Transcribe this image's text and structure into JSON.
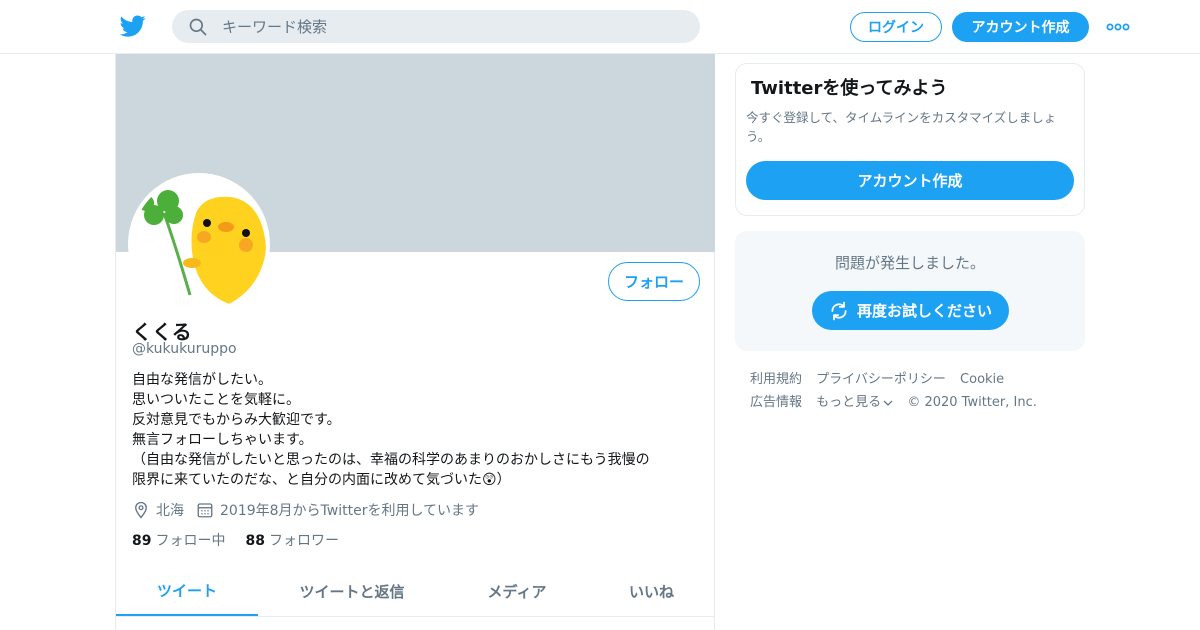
{
  "header": {
    "search_placeholder": "キーワード検索",
    "login_label": "ログイン",
    "signup_label": "アカウント作成"
  },
  "profile": {
    "follow_label": "フォロー",
    "display_name": "くくる",
    "handle": "@kukukuruppo",
    "bio_lines": [
      "自由な発信がしたい。",
      "思いついたことを気軽に。",
      "反対意見でもからみ大歓迎です。",
      "無言フォローしちゃいます。",
      "（自由な発信がしたいと思ったのは、幸福の科学のあまりのおかしさにもう我慢の",
      "限界に来ていたのだな、と自分の内面に改めて気づいた😲）"
    ],
    "location": "北海",
    "joined": "2019年8月からTwitterを利用しています",
    "following_count": "89",
    "following_label": "フォロー中",
    "followers_count": "88",
    "followers_label": "フォロワー"
  },
  "tabs": [
    {
      "label": "ツイート",
      "active": true
    },
    {
      "label": "ツイートと返信",
      "active": false
    },
    {
      "label": "メディア",
      "active": false
    },
    {
      "label": "いいね",
      "active": false
    }
  ],
  "sidebar": {
    "signup_title": "Twitterを使ってみよう",
    "signup_desc": "今すぐ登録して、タイムラインをカスタマイズしましょう。",
    "signup_cta": "アカウント作成",
    "error_message": "問題が発生しました。",
    "retry_label": "再度お試しください"
  },
  "footer": {
    "links": [
      "利用規約",
      "プライバシーポリシー",
      "Cookie",
      "広告情報",
      "もっと見る"
    ],
    "copyright": "© 2020 Twitter, Inc."
  },
  "colors": {
    "accent": "#1da1f2",
    "banner": "#ccd6dd",
    "muted_text": "#657786"
  },
  "icons": [
    "twitter-bird-icon",
    "search-icon",
    "more-dots-icon",
    "location-pin-icon",
    "calendar-icon",
    "refresh-icon",
    "chevron-down-icon"
  ]
}
